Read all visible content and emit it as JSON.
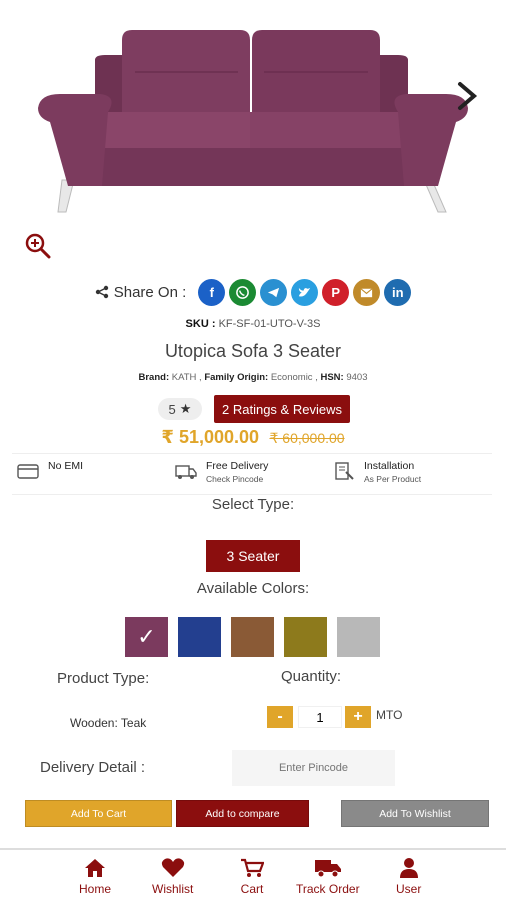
{
  "share": {
    "label": "Share On :",
    "icons": [
      "facebook-icon",
      "whatsapp-icon",
      "telegram-icon",
      "twitter-icon",
      "pinterest-icon",
      "email-icon",
      "linkedin-icon"
    ]
  },
  "sku": {
    "label": "SKU :",
    "value": "KF-SF-01-UTO-V-3S"
  },
  "product": {
    "title": "Utopica Sofa 3 Seater",
    "brand_label": "Brand:",
    "brand": "KATH ,",
    "origin_label": "Family Origin:",
    "origin": "Economic ,",
    "hsn_label": "HSN:",
    "hsn": "9403"
  },
  "rating": {
    "value": "5",
    "reviews_label": "2 Ratings & Reviews"
  },
  "price": {
    "current": "₹ 51,000.00",
    "mrp": "₹ 60,000.00"
  },
  "info": {
    "emi": "No EMI",
    "delivery": "Free Delivery",
    "delivery_sub": "Check Pincode",
    "install": "Installation",
    "install_sub": "As Per Product"
  },
  "select_type": {
    "label": "Select Type:",
    "selected": "3 Seater"
  },
  "colors": {
    "label": "Available Colors:",
    "swatches": [
      "#7b3a5e",
      "#233f8f",
      "#8a5a36",
      "#8d7a1c",
      "#b8b8b8"
    ],
    "selected_index": 0
  },
  "product_type": {
    "label": "Product Type:",
    "value": "Wooden: Teak"
  },
  "quantity": {
    "label": "Quantity:",
    "value": "1",
    "minus": "-",
    "plus": "+",
    "note": "MTO"
  },
  "delivery": {
    "label": "Delivery Detail :",
    "placeholder": "Enter Pincode"
  },
  "buttons": {
    "add_to_cart": "Add To Cart",
    "compare": "Add to compare",
    "wishlist": "Add To Wishlist"
  },
  "nav": {
    "home": "Home",
    "wishlist": "Wishlist",
    "cart": "Cart",
    "track": "Track Order",
    "user": "User"
  },
  "colors_theme": {
    "brand": "#8b0e0e",
    "accent": "#e0a52a",
    "sofa": "#7b3a5e"
  }
}
